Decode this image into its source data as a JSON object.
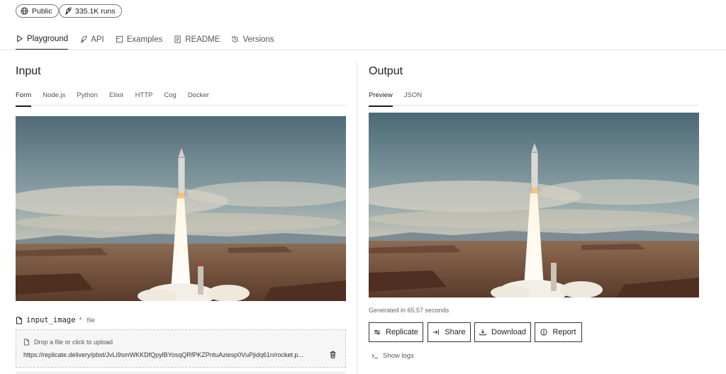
{
  "badges": [
    {
      "label": "Public",
      "icon": "globe-icon"
    },
    {
      "label": "335.1K runs",
      "icon": "rocket-icon"
    }
  ],
  "tabs": [
    {
      "label": "Playground",
      "icon": "play-icon",
      "active": true
    },
    {
      "label": "API",
      "icon": "rocket-icon"
    },
    {
      "label": "Examples",
      "icon": "examples-icon"
    },
    {
      "label": "README",
      "icon": "document-icon"
    },
    {
      "label": "Versions",
      "icon": "history-icon"
    }
  ],
  "input": {
    "title": "Input",
    "subtabs": [
      "Form",
      "Node.js",
      "Python",
      "Elixir",
      "HTTP",
      "Cog",
      "Docker"
    ],
    "field": {
      "name": "input_image",
      "required_mark": "*",
      "type": "file",
      "drop_text": "Drop a file or click to upload",
      "value": "https://replicate.delivery/pbxt/JvLi9smWKKDfQpylBYosqQRfPKZPntuAziesp0VuPjidq61n/rocket.p..."
    }
  },
  "output": {
    "title": "Output",
    "subtabs": [
      "Preview",
      "JSON"
    ],
    "generated_text": "Generated in 65.57 seconds",
    "buttons": [
      {
        "label": "Replicate",
        "icon": "sliders-icon"
      },
      {
        "label": "Share",
        "icon": "share-icon"
      },
      {
        "label": "Download",
        "icon": "download-icon"
      },
      {
        "label": "Report",
        "icon": "report-icon"
      }
    ],
    "logs_label": "Show logs"
  },
  "colors": {
    "text": "#222222",
    "muted": "#555555",
    "required": "#dd3333",
    "border": "#333333"
  }
}
